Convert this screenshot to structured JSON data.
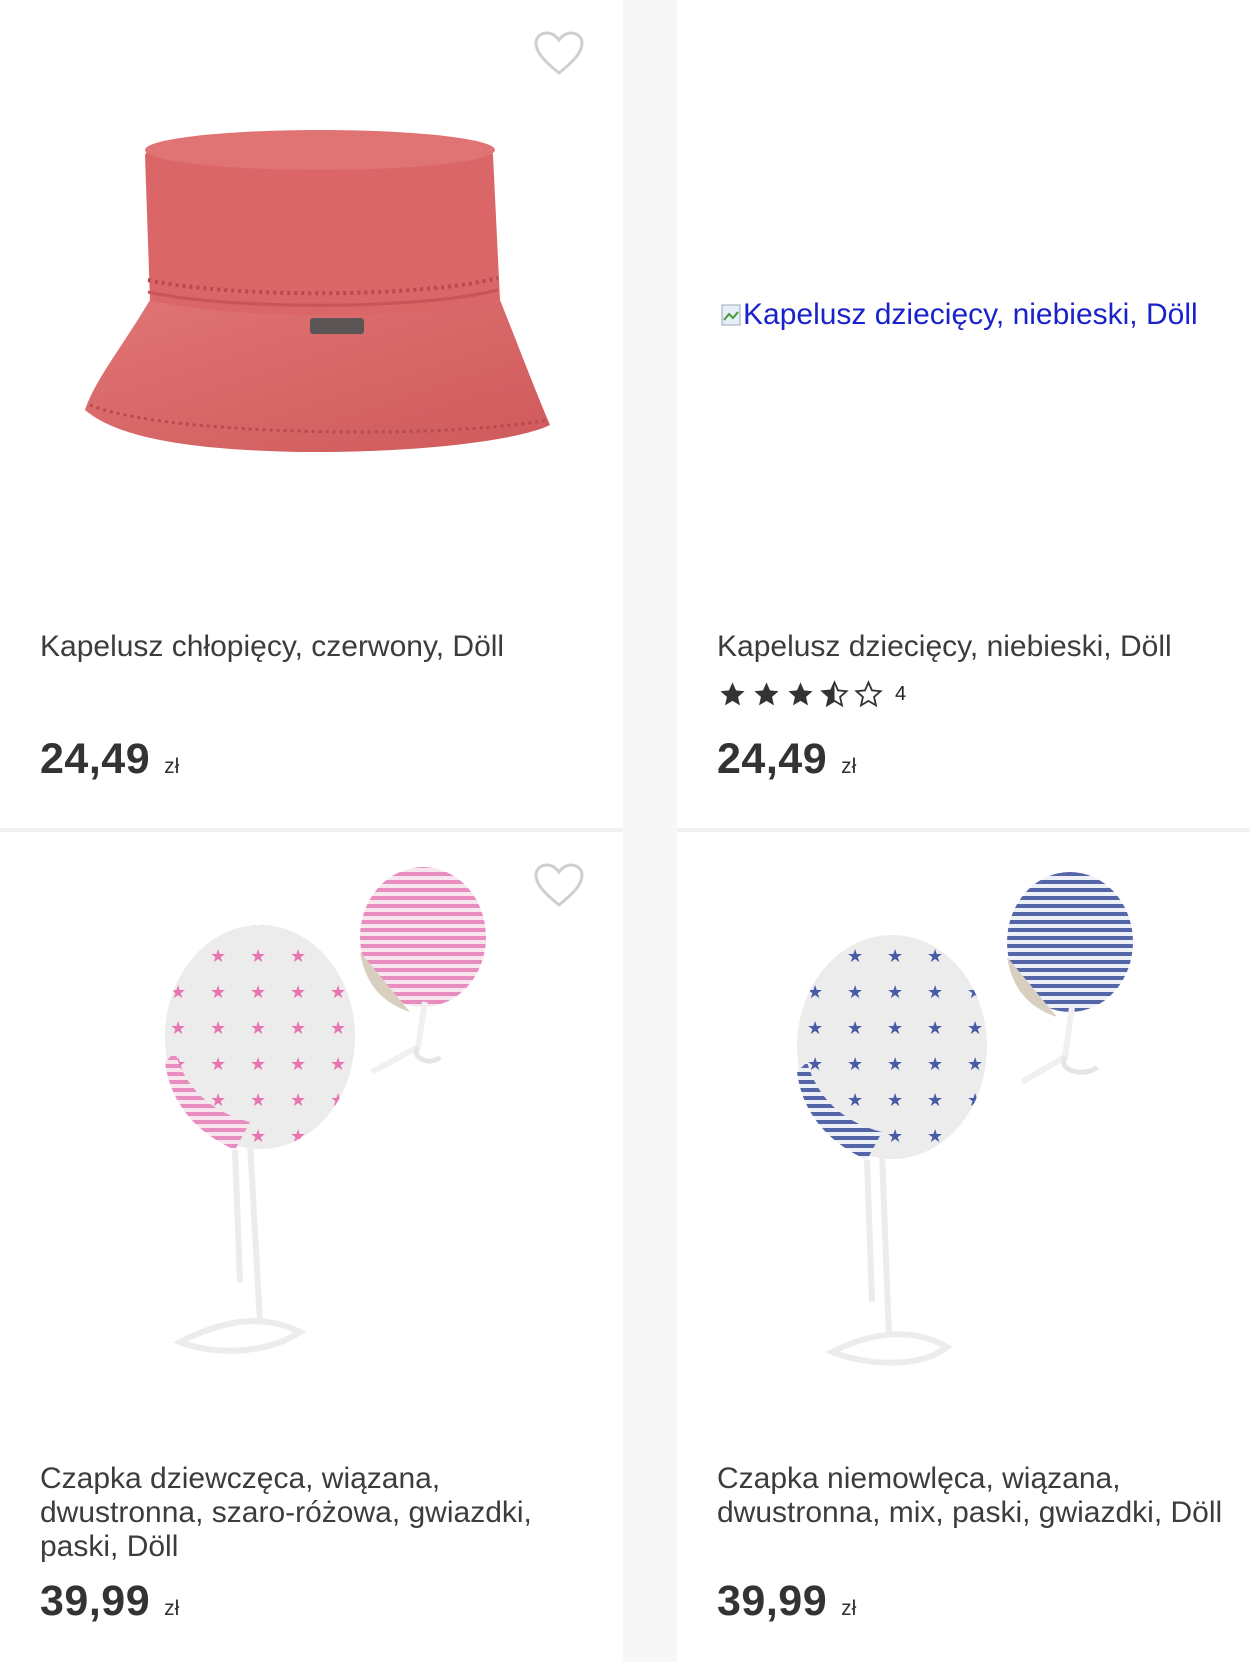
{
  "products": [
    {
      "title": "Kapelusz chłopięcy, czerwony, Döll",
      "price": "24,49",
      "currency": "zł",
      "image": "red-bucket-hat",
      "favorite_icon": "heart-outline-icon"
    },
    {
      "title": "Kapelusz dziecięcy, niebieski, Döll",
      "image_alt": "Kapelusz dziecięcy, niebieski, Döll",
      "rating": 3.5,
      "rating_count": "4",
      "price": "24,49",
      "currency": "zł",
      "favorite_icon": "heart-outline-icon"
    },
    {
      "title": "Czapka dziewczęca, wiązana, dwustronna, szaro-różowa, gwiazdki, paski, Döll",
      "price": "39,99",
      "currency": "zł",
      "image": "pink-star-baby-cap",
      "favorite_icon": "heart-outline-icon"
    },
    {
      "title": "Czapka niemowlęca, wiązana, dwustronna, mix, paski, gwiazdki, Döll",
      "price": "39,99",
      "currency": "zł",
      "image": "blue-star-baby-cap",
      "favorite_icon": "heart-outline-icon"
    }
  ],
  "colors": {
    "hat_red": "#d96566",
    "star_pink": "#e874b0",
    "star_blue": "#4a5ba8",
    "link_blue": "#1a22c9"
  }
}
